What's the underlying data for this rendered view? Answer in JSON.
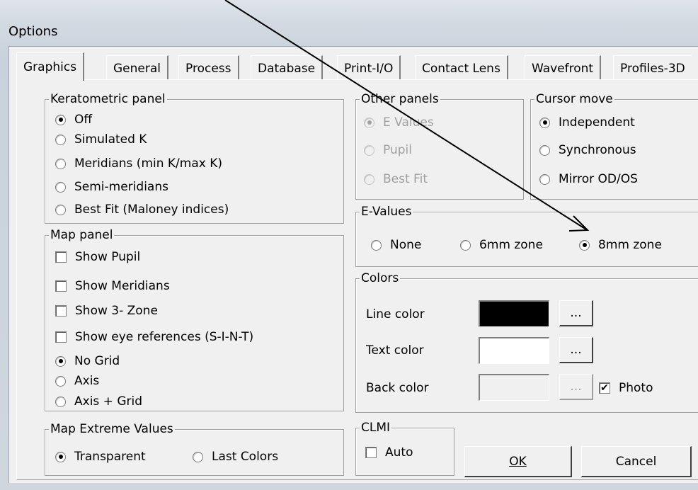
{
  "window": {
    "title": "Options"
  },
  "tabs": [
    {
      "label": "Graphics",
      "active": true
    },
    {
      "label": "General",
      "active": false
    },
    {
      "label": "Process",
      "active": false
    },
    {
      "label": "Database",
      "active": false
    },
    {
      "label": "Print-I/O",
      "active": false
    },
    {
      "label": "Contact Lens",
      "active": false
    },
    {
      "label": "Wavefront",
      "active": false
    },
    {
      "label": "Profiles-3D",
      "active": false
    }
  ],
  "keratometric": {
    "title": "Keratometric panel",
    "options": [
      {
        "label": "Off",
        "checked": true
      },
      {
        "label": "Simulated K",
        "checked": false
      },
      {
        "label": "Meridians (min K/max K)",
        "checked": false
      },
      {
        "label": "Semi-meridians",
        "checked": false
      },
      {
        "label": "Best Fit (Maloney indices)",
        "checked": false
      }
    ]
  },
  "map_panel": {
    "title": "Map panel",
    "checkboxes": [
      {
        "label": "Show Pupil",
        "checked": false
      },
      {
        "label": "Show Meridians",
        "checked": false
      },
      {
        "label": "Show 3- Zone",
        "checked": false
      },
      {
        "label": "Show eye references (S-I-N-T)",
        "checked": false
      }
    ],
    "grid_options": [
      {
        "label": "No Grid",
        "checked": true
      },
      {
        "label": "Axis",
        "checked": false
      },
      {
        "label": "Axis + Grid",
        "checked": false
      }
    ]
  },
  "map_extreme": {
    "title": "Map Extreme Values",
    "options": [
      {
        "label": "Transparent",
        "checked": true
      },
      {
        "label": "Last Colors",
        "checked": false
      }
    ]
  },
  "other_panels": {
    "title": "Other panels",
    "options": [
      {
        "label": "E Values",
        "checked": true
      },
      {
        "label": "Pupil",
        "checked": false
      },
      {
        "label": "Best Fit",
        "checked": false
      }
    ]
  },
  "cursor_move": {
    "title": "Cursor move",
    "options": [
      {
        "label": "Independent",
        "checked": true
      },
      {
        "label": "Synchronous",
        "checked": false
      },
      {
        "label": "Mirror OD/OS",
        "checked": false
      }
    ]
  },
  "e_values": {
    "title": "E-Values",
    "options": [
      {
        "label": "None",
        "checked": false
      },
      {
        "label": "6mm zone",
        "checked": false
      },
      {
        "label": "8mm zone",
        "checked": true
      }
    ]
  },
  "colors": {
    "title": "Colors",
    "rows": [
      {
        "label": "Line color",
        "swatch": "#000000",
        "button": "...",
        "enabled": true
      },
      {
        "label": "Text color",
        "swatch": "#ffffff",
        "button": "...",
        "enabled": true
      },
      {
        "label": "Back color",
        "swatch": "#f0f0f0",
        "button": "...",
        "enabled": false
      }
    ],
    "photo": {
      "label": "Photo",
      "checked": true
    }
  },
  "clmi": {
    "title": "CLMI",
    "auto": {
      "label": "Auto",
      "checked": false
    }
  },
  "buttons": {
    "ok": "OK",
    "cancel": "Cancel"
  }
}
